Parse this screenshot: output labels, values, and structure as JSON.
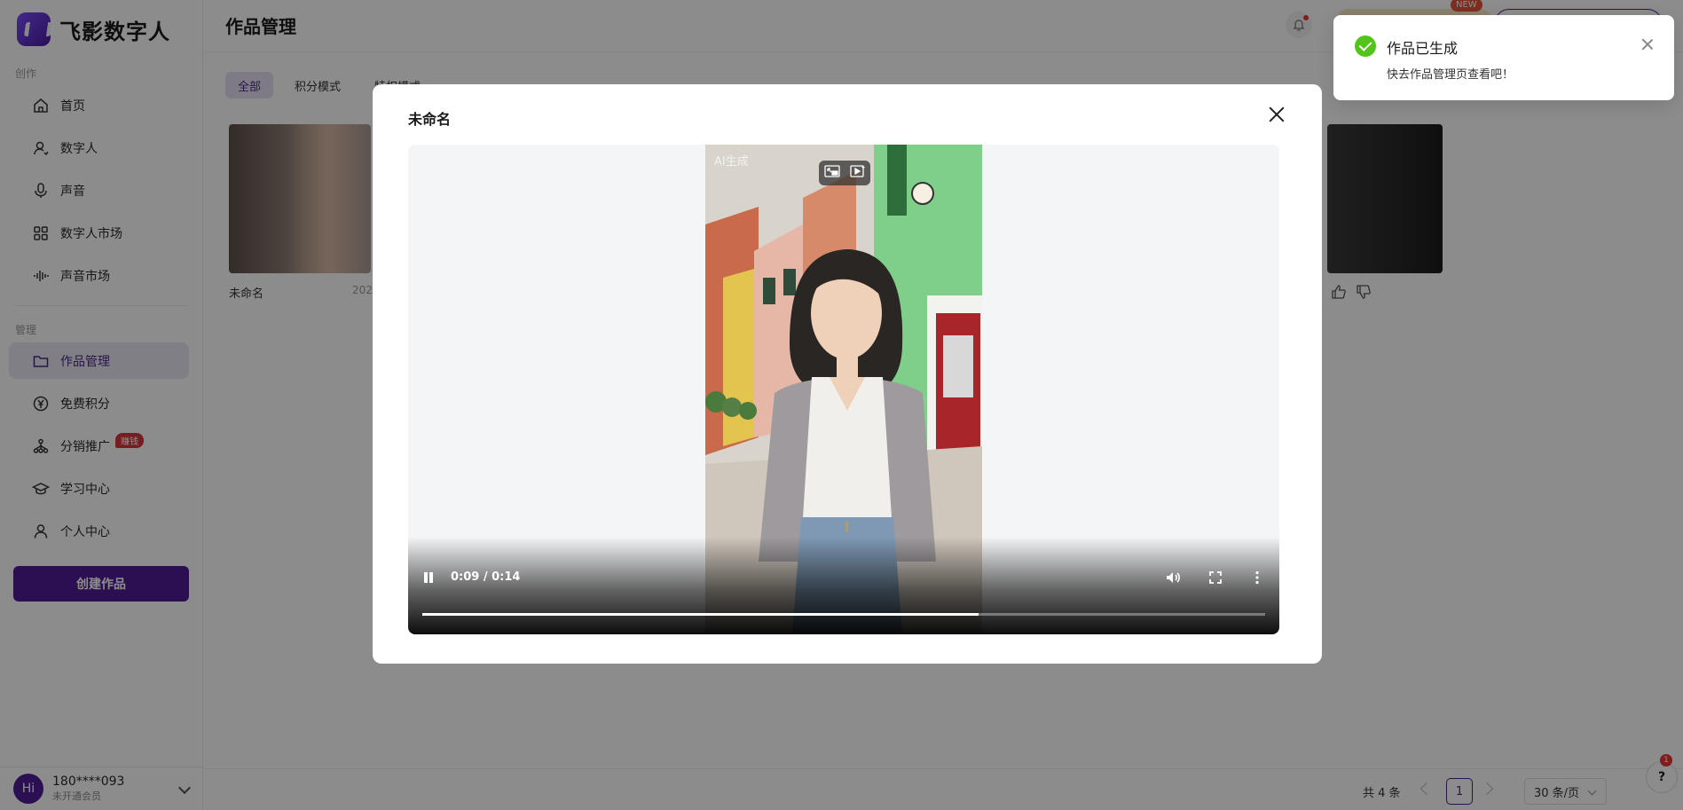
{
  "brand": {
    "name": "飞影数字人"
  },
  "sidebar": {
    "section_create": "创作",
    "section_manage": "管理",
    "items": [
      {
        "label": "首页",
        "icon": "home-icon"
      },
      {
        "label": "数字人",
        "icon": "user-icon"
      },
      {
        "label": "声音",
        "icon": "mic-icon"
      },
      {
        "label": "数字人市场",
        "icon": "grid-icon"
      },
      {
        "label": "声音市场",
        "icon": "waveform-icon"
      },
      {
        "label": "作品管理",
        "icon": "folder-icon",
        "active": true
      },
      {
        "label": "免费积分",
        "icon": "yen-coin-icon"
      },
      {
        "label": "分销推广",
        "icon": "network-icon",
        "badge": "赚钱"
      },
      {
        "label": "学习中心",
        "icon": "graduation-cap-icon"
      },
      {
        "label": "个人中心",
        "icon": "person-icon"
      }
    ],
    "create_button": "创建作品",
    "user": {
      "avatar": "Hi",
      "phone": "180****093",
      "status": "未开通会员"
    }
  },
  "header": {
    "title": "作品管理",
    "new_badge": "NEW"
  },
  "tabs": [
    {
      "label": "全部",
      "active": true
    },
    {
      "label": "积分模式"
    },
    {
      "label": "特权模式"
    }
  ],
  "works": [
    {
      "title": "未命名",
      "date": "202"
    }
  ],
  "pagination": {
    "total": "共 4 条",
    "page": "1",
    "page_size": "30 条/页"
  },
  "help": {
    "count": "1"
  },
  "modal": {
    "title": "未命名",
    "watermark": "AI生成",
    "time": "0:09 / 0:14",
    "progress": 0.66
  },
  "toast": {
    "title": "作品已生成",
    "body": "快去作品管理页查看吧！"
  },
  "colors": {
    "primary": "#4f1d96",
    "success": "#52c41a",
    "badge": "#d9363e"
  }
}
